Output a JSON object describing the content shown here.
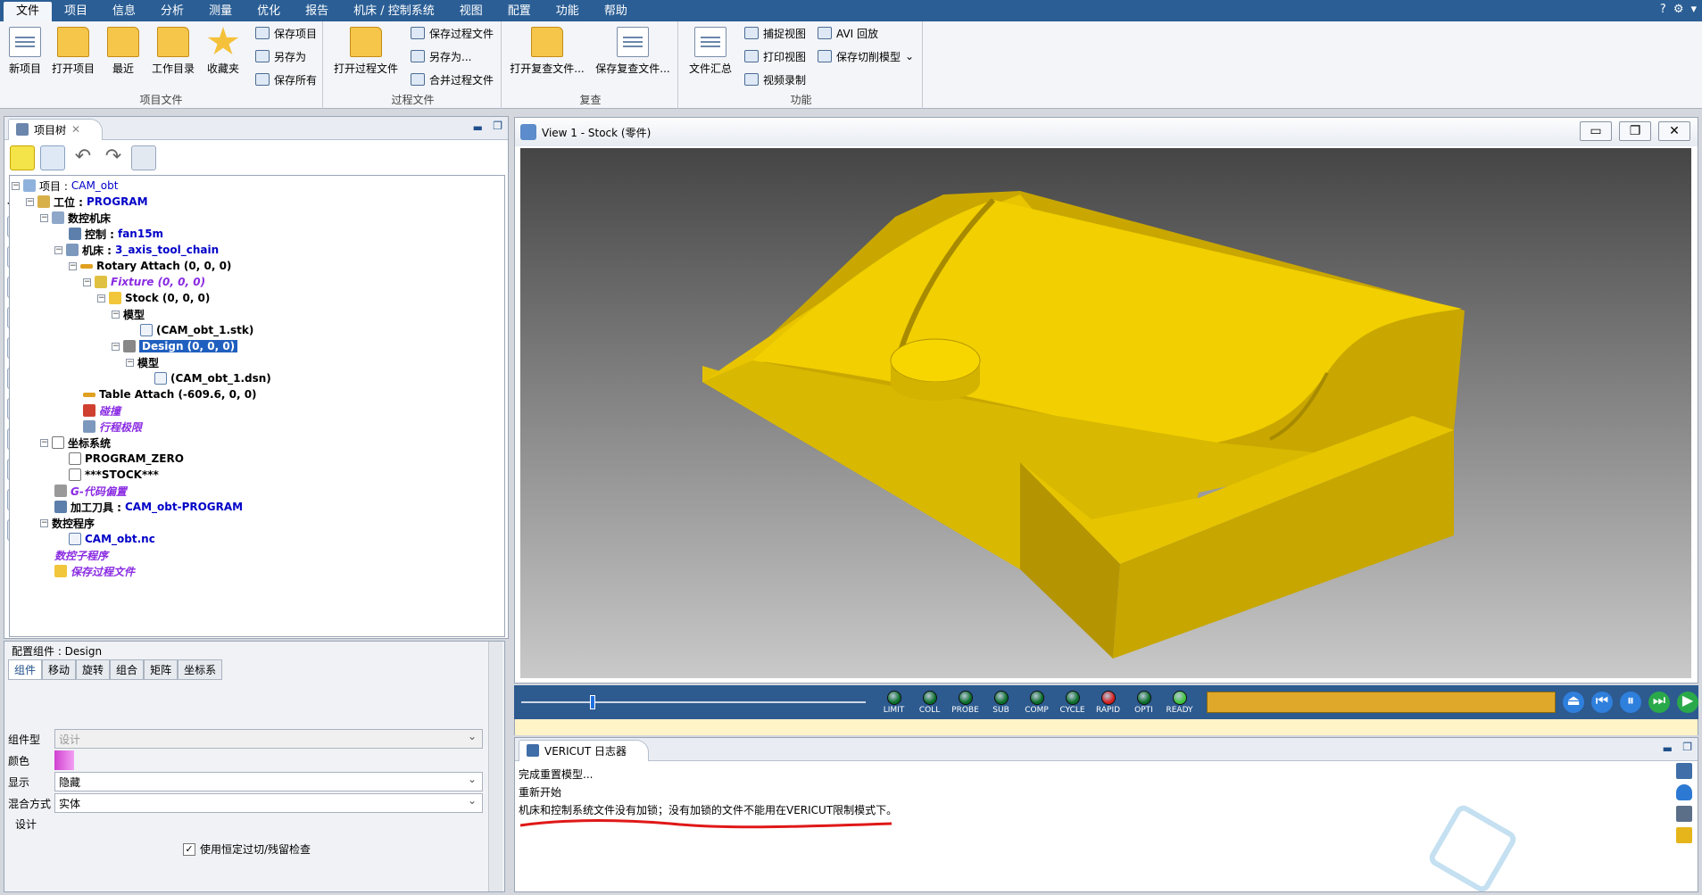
{
  "menu": {
    "items": [
      "文件",
      "项目",
      "信息",
      "分析",
      "测量",
      "优化",
      "报告",
      "机床 / 控制系统",
      "视图",
      "配置",
      "功能",
      "帮助"
    ],
    "right": [
      "?",
      "⚙",
      "▾"
    ]
  },
  "ribbon": {
    "groups": {
      "project": {
        "label": "项目文件",
        "new": "新项目",
        "open": "打开项目",
        "recent": "最近",
        "workdir": "工作目录",
        "favorites": "收藏夹",
        "save": "保存项目",
        "saveas": "另存为",
        "saveall": "保存所有"
      },
      "process": {
        "label": "过程文件",
        "open": "打开过程文件",
        "save": "保存过程文件",
        "saveas": "另存为...",
        "merge": "合并过程文件"
      },
      "review": {
        "label": "复查",
        "open": "打开复查文件...",
        "save": "保存复查文件..."
      },
      "func": {
        "label": "功能",
        "summary": "文件汇总",
        "capture": "捕捉视图",
        "print": "打印视图",
        "video": "视频录制",
        "avi": "AVI 回放",
        "savecut": "保存切削模型"
      }
    }
  },
  "tree": {
    "tab": "项目树",
    "nodes": {
      "project_label": "项目 : ",
      "project_name": "CAM_obt",
      "station_label": "工位 : ",
      "station_name": "PROGRAM",
      "nc_machine": "数控机床",
      "control_label": "控制 : ",
      "control_name": "fan15m",
      "machine_label": "机床 : ",
      "machine_name": "3_axis_tool_chain",
      "rotary": "Rotary Attach (0, 0, 0)",
      "fixture": "Fixture (0, 0, 0)",
      "stock": "Stock (0, 0, 0)",
      "model1": "模型",
      "stk": "(CAM_obt_1.stk)",
      "design": "Design (0, 0, 0)",
      "model2": "模型",
      "dsn": "(CAM_obt_1.dsn)",
      "table": "Table Attach (-609.6, 0, 0)",
      "collision": "碰撞",
      "travel": "行程极限",
      "coord": "坐标系统",
      "pzero": "PROGRAM_ZERO",
      "stockcs": "***STOCK***",
      "goffset": "G-代码偏置",
      "tool_label": "加工刀具 : ",
      "tool_name": "CAM_obt-PROGRAM",
      "ncprog": "数控程序",
      "ncfile": "CAM_obt.nc",
      "subprog": "数控子程序",
      "saveproc": "保存过程文件"
    }
  },
  "config": {
    "title": "配置组件 : Design",
    "tabs": [
      "组件",
      "移动",
      "旋转",
      "组合",
      "矩阵",
      "坐标系"
    ],
    "type_label": "组件型",
    "type_value": "设计",
    "color_label": "颜色",
    "display_label": "显示",
    "display_value": "隐藏",
    "blend_label": "混合方式",
    "blend_value": "实体",
    "section": "设计",
    "check_label": "使用恒定过切/残留检查"
  },
  "view": {
    "title": "View 1 - Stock (零件)",
    "buttons": [
      "▭",
      "❐",
      "✕"
    ]
  },
  "playbar": {
    "leds": [
      "LIMIT",
      "COLL",
      "PROBE",
      "SUB",
      "COMP",
      "CYCLE",
      "RAPID",
      "OPTI",
      "READY"
    ],
    "led_colors": [
      "#0a6e2a",
      "#0a6e2a",
      "#0a6e2a",
      "#0a6e2a",
      "#0a6e2a",
      "#0a6e2a",
      "#d22020",
      "#0a6e2a",
      "#3ec43e"
    ],
    "progress": 0.2
  },
  "log": {
    "title": "VERICUT 日志器",
    "lines": [
      "完成重置模型...",
      "重新开始",
      "机床和控制系统文件没有加锁；没有加锁的文件不能用在VERICUT限制模式下。"
    ]
  },
  "colors": {
    "accent": "#2a5e95",
    "model": "#e6c200"
  }
}
